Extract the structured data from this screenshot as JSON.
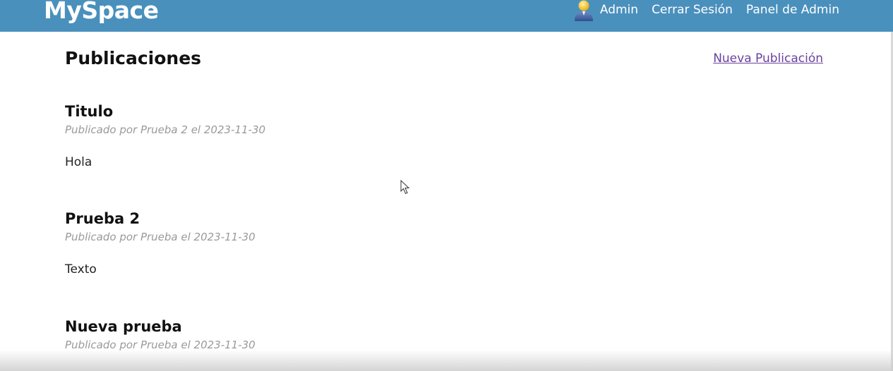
{
  "colors": {
    "navbar": "#4a90bd",
    "link_visited": "#6b3fa0",
    "meta_text": "#9a9a9a"
  },
  "navbar": {
    "brand": "MySpace",
    "user_icon": "user-avatar-icon",
    "user_label": "Admin",
    "logout_label": "Cerrar Sesión",
    "admin_panel_label": "Panel de Admin"
  },
  "main": {
    "title": "Publicaciones",
    "new_post_label": "Nueva Publicación",
    "posts": [
      {
        "title": "Titulo",
        "meta": "Publicado por Prueba 2 el 2023-11-30",
        "body": "Hola"
      },
      {
        "title": "Prueba 2",
        "meta": "Publicado por Prueba el 2023-11-30",
        "body": "Texto"
      },
      {
        "title": "Nueva prueba",
        "meta": "Publicado por Prueba el 2023-11-30",
        "body": ""
      }
    ]
  }
}
